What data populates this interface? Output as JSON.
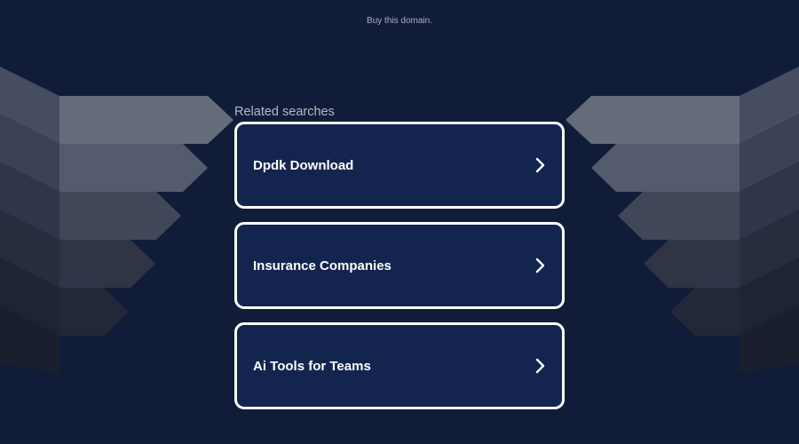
{
  "header": {
    "buy_text": "Buy this domain."
  },
  "related": {
    "title": "Related searches",
    "items": [
      {
        "label": "Dpdk Download"
      },
      {
        "label": "Insurance Companies"
      },
      {
        "label": "Ai Tools for Teams"
      }
    ]
  },
  "icons": {
    "result_arrow": "chevron-right-icon"
  },
  "colors": {
    "background": "#111d38",
    "card_background": "#13254f",
    "card_border": "#ffffff",
    "text": "#ffffff",
    "muted_text": "#b4bac6"
  }
}
